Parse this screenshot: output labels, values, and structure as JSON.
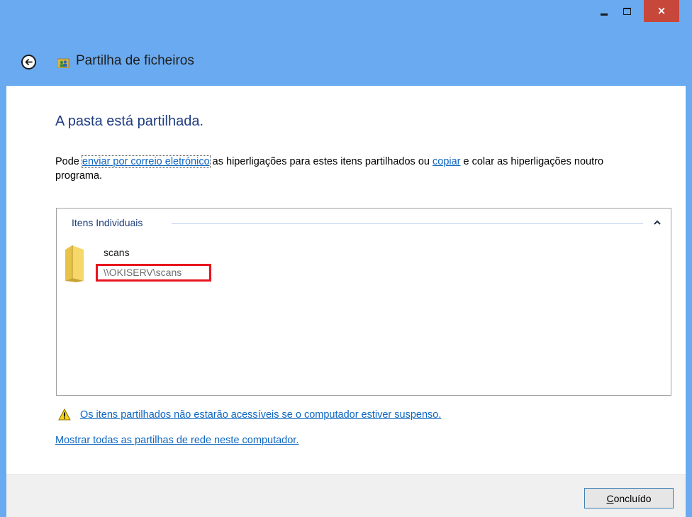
{
  "window": {
    "title": "Partilha de ficheiros",
    "controls": {
      "minimize": "minimize",
      "maximize": "maximize",
      "close": "×"
    },
    "accent_color": "#6aaaf0",
    "close_color": "#c7473b"
  },
  "header": {
    "back_icon": "back-arrow-icon",
    "app_icon": "people-share-icon",
    "title": "Partilha de ficheiros"
  },
  "content": {
    "heading": "A pasta está partilhada.",
    "intro": {
      "prefix": "Pode ",
      "email_link": "enviar por correio eletrónico",
      "middle": " as hiperligações para estes itens partilhados ou ",
      "copy_link": "copiar",
      "suffix": " e colar as hiperligações noutro programa."
    },
    "group": {
      "label": "Itens Individuais",
      "collapse_icon": "chevron-up-icon",
      "items": [
        {
          "icon": "folder-icon",
          "name": "scans",
          "path": "\\\\OKISERV\\scans"
        }
      ]
    },
    "warning": {
      "icon": "warning-icon",
      "text": "Os itens partilhados não estarão acessíveis se o computador estiver suspenso."
    },
    "show_all_shares": "Mostrar todas as partilhas de rede neste computador.",
    "link_color": "#0d66c2",
    "highlight_color": "#e8141e"
  },
  "footer": {
    "done_button": {
      "accel": "C",
      "rest": "oncluído"
    }
  }
}
